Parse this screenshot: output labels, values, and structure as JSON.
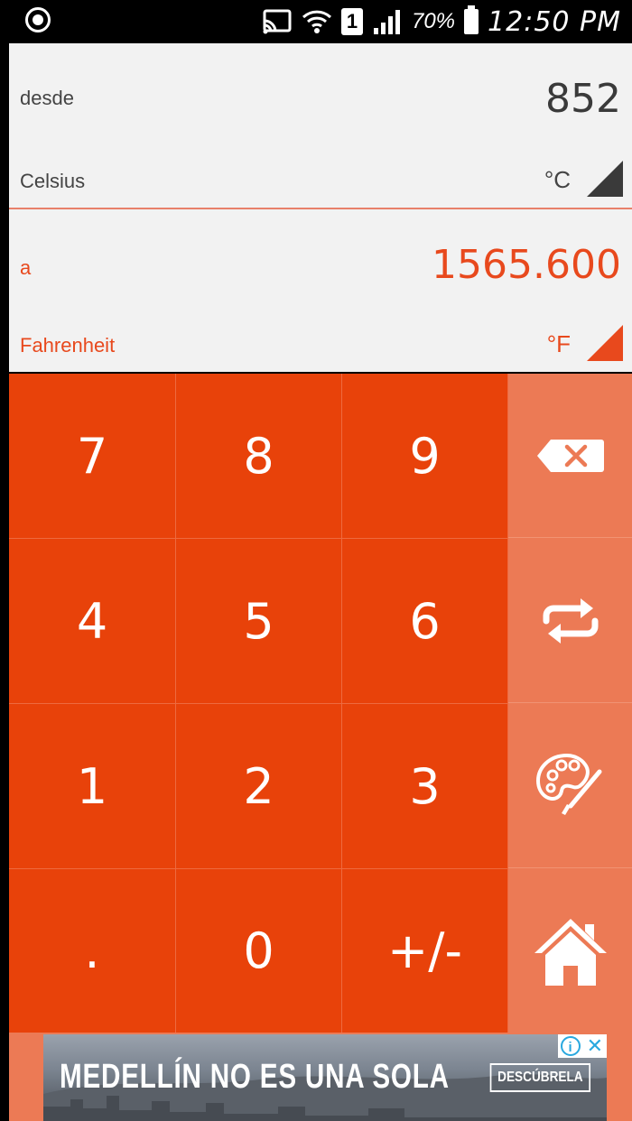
{
  "status_bar": {
    "sim_slot": "1",
    "battery": "70%",
    "time": "12:50 PM"
  },
  "from_panel": {
    "label": "desde",
    "value": "852",
    "unit_name": "Celsius",
    "unit_symbol": "°C"
  },
  "to_panel": {
    "label": "a",
    "value": "1565.600",
    "unit_name": "Fahrenheit",
    "unit_symbol": "°F"
  },
  "keypad": {
    "k7": "7",
    "k8": "8",
    "k9": "9",
    "k4": "4",
    "k5": "5",
    "k6": "6",
    "k1": "1",
    "k2": "2",
    "k3": "3",
    "kdot": ".",
    "k0": "0",
    "ksign": "+/-"
  },
  "side_actions": {
    "icons": [
      "backspace-icon",
      "swap-icon",
      "palette-icon",
      "home-icon"
    ]
  },
  "ad": {
    "headline": "MEDELLÍN NO ES UNA SOLA",
    "cta": "DESCÚBRELA",
    "info": "i",
    "close": "✕"
  },
  "colors": {
    "accent": "#e8420a",
    "side_column": "#ec7a55",
    "result_text": "#e8491d",
    "panel_background": "#f2f2f2"
  }
}
